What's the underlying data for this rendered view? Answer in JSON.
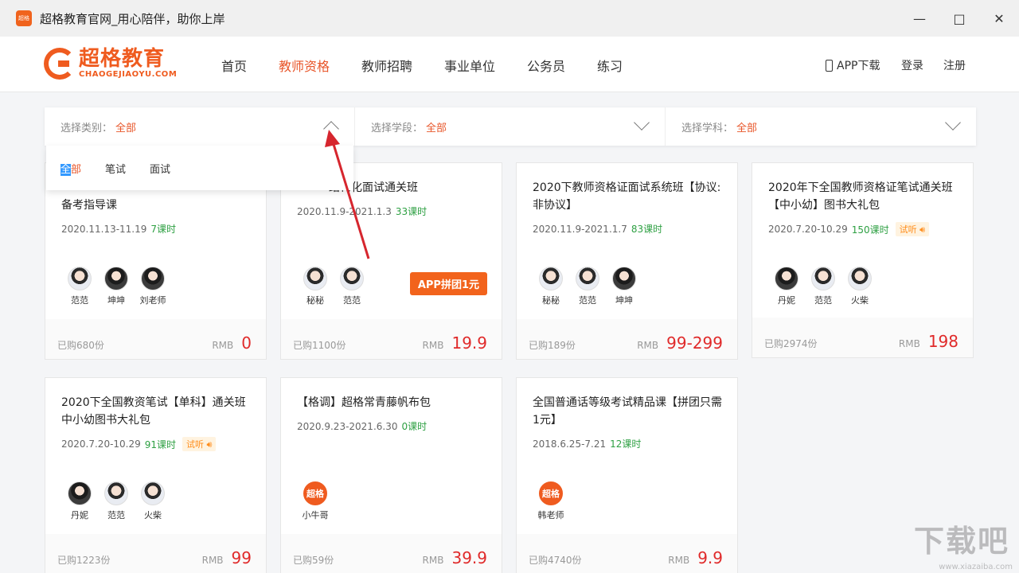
{
  "window": {
    "icon_text": "超格",
    "title": "超格教育官网_用心陪伴，助你上岸"
  },
  "logo": {
    "cn": "超格教育",
    "en": "CHAOGEJIAOYU.COM"
  },
  "nav": {
    "items": [
      "首页",
      "教师资格",
      "教师招聘",
      "事业单位",
      "公务员",
      "练习"
    ],
    "active": "教师资格",
    "app_download": "APP下载",
    "login": "登录",
    "register": "注册"
  },
  "filters": [
    {
      "label": "选择类别：",
      "value": "全部"
    },
    {
      "label": "选择学段：",
      "value": "全部"
    },
    {
      "label": "选择学科：",
      "value": "全部"
    }
  ],
  "dropdown": {
    "options": [
      "全部",
      "笔试",
      "面试"
    ],
    "highlight": "全",
    "rest": "部"
  },
  "cards": [
    {
      "title": "备考指导课",
      "date": "2020.11.13-11.19",
      "lessons": "7课时",
      "teachers": [
        "范范",
        "坤坤",
        "刘老师"
      ],
      "bought": "已购680份",
      "rmb": "RMB",
      "price": "0"
    },
    {
      "title": "结构化面试通关班",
      "date": "2020.11.9-2021.1.3",
      "lessons": "33课时",
      "teachers": [
        "秘秘",
        "范范"
      ],
      "badge": "APP拼团1元",
      "bought": "已购1100份",
      "rmb": "RMB",
      "price": "19.9"
    },
    {
      "title": "2020下教师资格证面试系统班【协议:非协议】",
      "date": "2020.11.9-2021.1.7",
      "lessons": "83课时",
      "teachers": [
        "秘秘",
        "范范",
        "坤坤"
      ],
      "bought": "已购189份",
      "rmb": "RMB",
      "price": "99-299"
    },
    {
      "title": "2020年下全国教师资格证笔试通关班【中小幼】图书大礼包",
      "date": "2020.7.20-10.29",
      "lessons": "150课时",
      "trial": "试听",
      "teachers": [
        "丹妮",
        "范范",
        "火柴"
      ],
      "bought": "已购2974份",
      "rmb": "RMB",
      "price": "198"
    },
    {
      "title": "2020下全国教资笔试【单科】通关班中小幼图书大礼包",
      "date": "2020.7.20-10.29",
      "lessons": "91课时",
      "trial": "试听",
      "teachers": [
        "丹妮",
        "范范",
        "火柴"
      ],
      "bought": "已购1223份",
      "rmb": "RMB",
      "price": "99"
    },
    {
      "title": "【格调】超格常青藤帆布包",
      "date": "2020.9.23-2021.6.30",
      "lessons": "0课时",
      "teachers": [
        "小牛哥"
      ],
      "bought": "已购59份",
      "rmb": "RMB",
      "price": "39.9"
    },
    {
      "title": "全国普通话等级考试精品课【拼团只需1元】",
      "date": "2018.6.25-7.21",
      "lessons": "12课时",
      "teachers": [
        "韩老师"
      ],
      "bought": "已购4740份",
      "rmb": "RMB",
      "price": "9.9"
    }
  ],
  "brand_avatar_text": "超格",
  "watermark": {
    "big": "下载吧",
    "small": "www.xiazaiba.com"
  }
}
